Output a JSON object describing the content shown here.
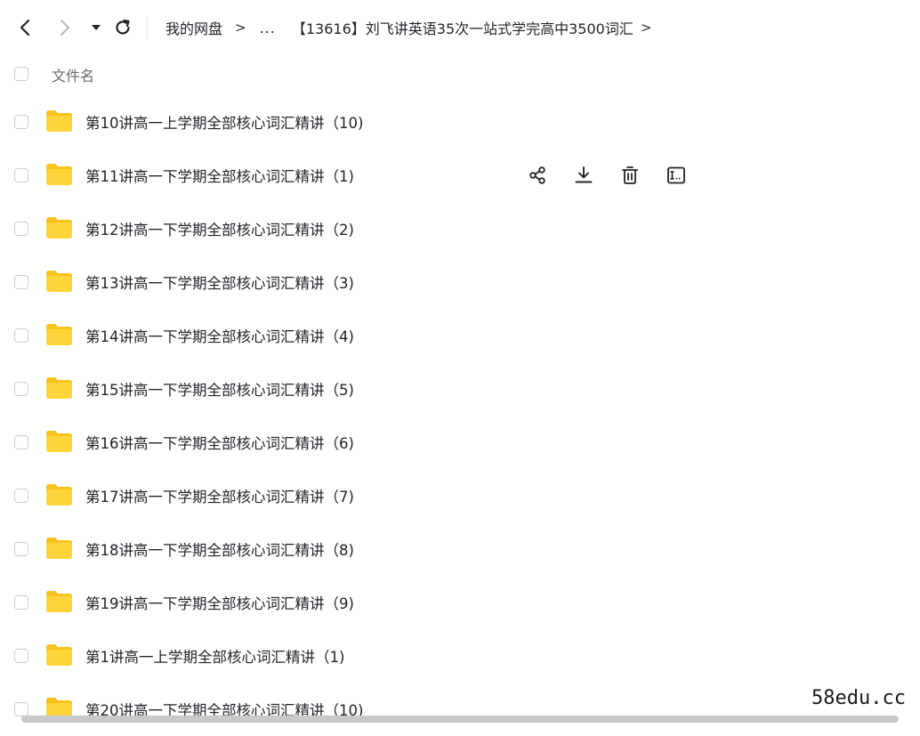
{
  "toolbar": {
    "icons": [
      "back-arrow-icon",
      "forward-arrow-icon",
      "dropdown-caret-icon",
      "refresh-icon"
    ]
  },
  "breadcrumb": {
    "items": [
      "我的网盘",
      "...",
      "【13616】刘飞讲英语35次一站式学完高中3500词汇"
    ],
    "separator": ">"
  },
  "list_header": {
    "name_label": "文件名"
  },
  "files": [
    {
      "name": "第10讲高一上学期全部核心词汇精讲（10)"
    },
    {
      "name": "第11讲高一下学期全部核心词汇精讲（1)"
    },
    {
      "name": "第12讲高一下学期全部核心词汇精讲（2)"
    },
    {
      "name": "第13讲高一下学期全部核心词汇精讲（3)"
    },
    {
      "name": "第14讲高一下学期全部核心词汇精讲（4)"
    },
    {
      "name": "第15讲高一下学期全部核心词汇精讲（5)"
    },
    {
      "name": "第16讲高一下学期全部核心词汇精讲（6)"
    },
    {
      "name": "第17讲高一下学期全部核心词汇精讲（7)"
    },
    {
      "name": "第18讲高一下学期全部核心词汇精讲（8)"
    },
    {
      "name": "第19讲高一下学期全部核心词汇精讲（9)"
    },
    {
      "name": "第1讲高一上学期全部核心词汇精讲（1)"
    },
    {
      "name": "第20讲高一下学期全部核心词汇精讲（10)"
    }
  ],
  "row_actions": {
    "row_index": 1,
    "icons": [
      "share-icon",
      "download-icon",
      "delete-icon",
      "rename-icon"
    ]
  },
  "watermark": "58edu.cc",
  "colors": {
    "folder": "#FFD43B",
    "folder_tab": "#F6C21C",
    "text": "#1F2329",
    "muted": "#666A70"
  }
}
